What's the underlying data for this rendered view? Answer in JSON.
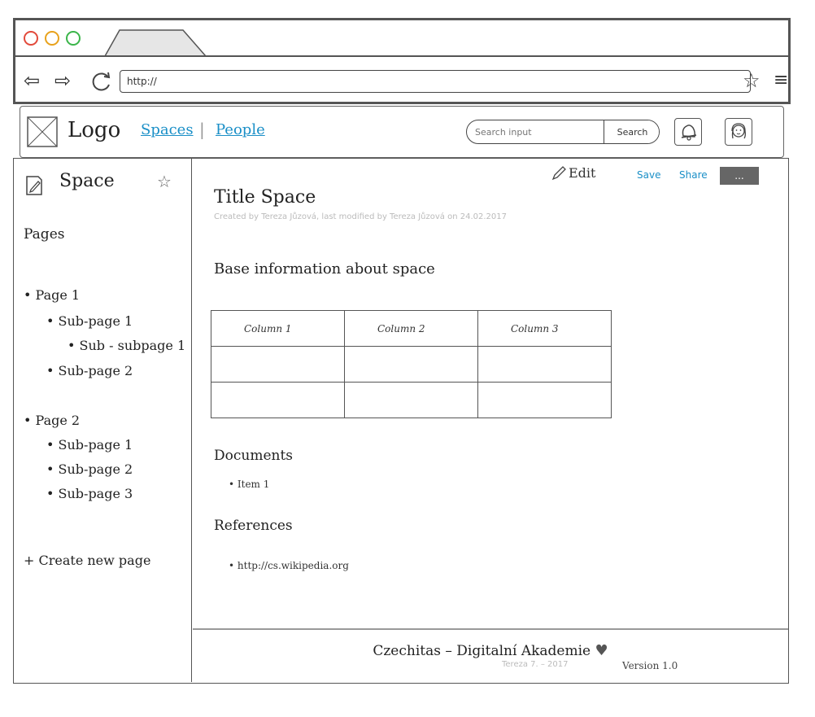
{
  "browser": {
    "url": "http://",
    "traffic_colors": [
      "#e24a3b",
      "#e8a21c",
      "#3bb54a"
    ]
  },
  "header": {
    "logo": "Logo",
    "nav": [
      {
        "label": "Spaces"
      },
      {
        "label": "People"
      }
    ],
    "nav_separator": "|",
    "search_placeholder": "Search input",
    "search_button": "Search"
  },
  "sidebar": {
    "title": "Space",
    "pages_label": "Pages",
    "items": [
      {
        "label": "• Page 1"
      },
      {
        "label": "• Sub-page 1"
      },
      {
        "label": "• Sub - subpage 1"
      },
      {
        "label": "• Sub-page 2"
      },
      {
        "label": "• Page 2"
      },
      {
        "label": "• Sub-page 1"
      },
      {
        "label": "• Sub-page 2"
      },
      {
        "label": "• Sub-page 3"
      }
    ],
    "create_label": "+ Create new page"
  },
  "content": {
    "actions": {
      "edit": "Edit",
      "save": "Save",
      "share": "Share",
      "more": "..."
    },
    "title": "Title Space",
    "meta": "Created by Tereza Jůzová, last modified by Tereza Jůzová on 24.02.2017",
    "section_title": "Base information about space",
    "table": {
      "headers": [
        "Column 1",
        "Column 2",
        "Column 3"
      ],
      "rows": [
        [
          "",
          "",
          ""
        ],
        [
          "",
          "",
          ""
        ]
      ]
    },
    "documents": {
      "title": "Documents",
      "items": [
        "• Item 1"
      ]
    },
    "references": {
      "title": "References",
      "items": [
        "• http://cs.wikipedia.org"
      ]
    }
  },
  "footer": {
    "main": "Czechitas – Digitalní Akademie",
    "sub": "Tereza 7. – 2017",
    "version": "Version 1.0"
  },
  "colors": {
    "link": "#1a8fc7",
    "meta_text": "#bbbbbb",
    "more_button": "#666666"
  }
}
